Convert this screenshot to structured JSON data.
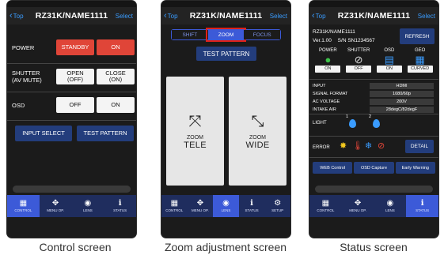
{
  "captions": [
    "Control screen",
    "Zoom adjustment screen",
    "Status screen"
  ],
  "control": {
    "back": "Top",
    "title": "RZ31K/NAME1111",
    "right": "Select",
    "power_label": "POWER",
    "standby": "STANDBY",
    "on": "ON",
    "shutter_label": "SHUTTER\n(AV MUTE)",
    "open": "OPEN\n(OFF)",
    "close": "CLOSE\n(ON)",
    "osd_label": "OSD",
    "osd_off": "OFF",
    "osd_on": "ON",
    "input_select": "INPUT SELECT",
    "test_pattern": "TEST PATTERN"
  },
  "zoom": {
    "back": "Top",
    "title": "RZ31K/NAME1111",
    "right": "Select",
    "tabs": [
      "SHIFT",
      "ZOOM",
      "FOCUS"
    ],
    "test_pattern": "TEST PATTERN",
    "tele_small": "ZOOM",
    "tele_big": "TELE",
    "wide_small": "ZOOM",
    "wide_big": "WIDE"
  },
  "status": {
    "back": "Top",
    "title": "RZ31K/NAME1111",
    "right": "Select",
    "name": "RZ31K/NAME1111",
    "ver": "Ver.1.00",
    "serial": "S/N SN1234567",
    "refresh": "REFRESH",
    "cols": [
      {
        "title": "POWER",
        "value": "ON",
        "icon": "power-led-icon"
      },
      {
        "title": "SHUTTER",
        "value": "OFF",
        "icon": "shutter-icon"
      },
      {
        "title": "OSD",
        "value": "ON",
        "icon": "osd-icon"
      },
      {
        "title": "GEO",
        "value": "CURVED",
        "icon": "geometry-icon"
      }
    ],
    "info": [
      {
        "k": "INPUT",
        "v": "HDMI"
      },
      {
        "k": "SIGNAL FORMAT",
        "v": "1080/60p"
      },
      {
        "k": "AC VOLTAGE",
        "v": "200V"
      },
      {
        "k": "INTAKE AIR",
        "v": "28degC/82degF"
      }
    ],
    "light": "LIGHT",
    "light1": "1",
    "light2": "2",
    "error": "ERROR",
    "detail": "DETAIL",
    "web_control": "WEB Control",
    "osd_capture": "OSD Capture",
    "early_warning": "Early Warning"
  },
  "tabbars": {
    "p1": [
      "CONTROL",
      "MENU OP.",
      "LENS",
      "STATUS"
    ],
    "p2": [
      "CONTROL",
      "MENU OP.",
      "LENS",
      "STATUS",
      "SETUP"
    ],
    "p3": [
      "CONTROL",
      "MENU OP.",
      "LENS",
      "STATUS"
    ]
  },
  "colors": {
    "accent_blue": "#3c5ad8",
    "button_navy": "#233d7c",
    "red": "#e04538",
    "highlight_red": "#e0211a",
    "link_blue": "#3a9cff"
  }
}
